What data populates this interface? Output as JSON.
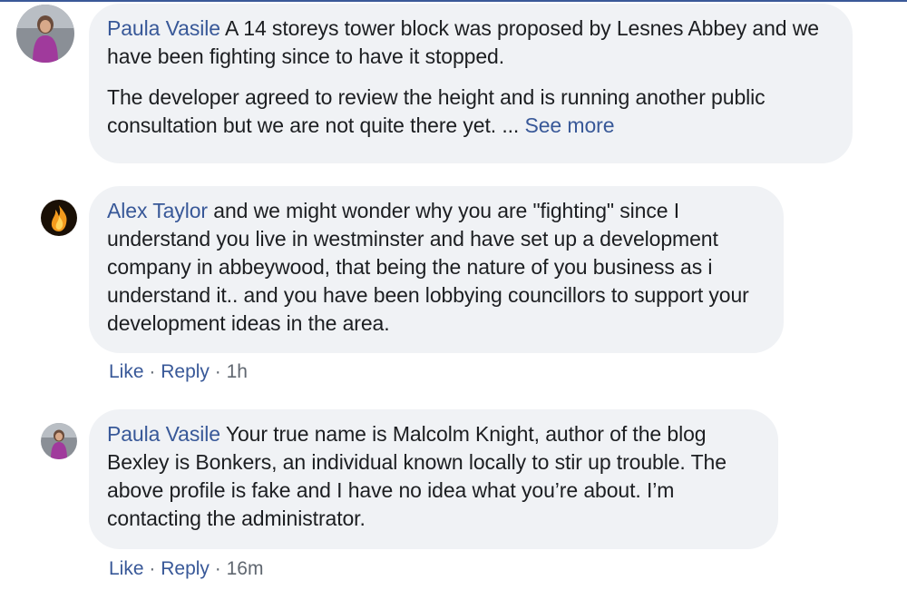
{
  "comments": [
    {
      "author": "Paula Vasile",
      "avatar_icon": "profile-photo-woman-purple-top",
      "paragraphs": [
        "A 14 storeys tower block was proposed by Lesnes Abbey and we have been fighting since to have it stopped.",
        "The developer agreed to review the height and is running another public consultation but we are not quite there yet. ..."
      ],
      "see_more": "See more"
    },
    {
      "author": "Alex Taylor",
      "avatar_icon": "profile-photo-flame",
      "text": "and we might wonder why you are \"fighting\" since I understand you live in westminster and have set up a development company in abbeywood, that being the nature of you business as i understand it.. and you have been lobbying councillors to support your development ideas in the area.",
      "actions": {
        "like": "Like",
        "sep": "·",
        "reply": "Reply",
        "time": "1h"
      }
    },
    {
      "author": "Paula Vasile",
      "avatar_icon": "profile-photo-woman-purple-top",
      "text": "Your true name is Malcolm Knight, author of the blog Bexley is Bonkers, an individual known locally to stir up trouble. The above profile is fake and I have no idea what you’re about. I’m contacting the administrator.",
      "actions": {
        "like": "Like",
        "sep": "·",
        "reply": "Reply",
        "time": "16m"
      }
    }
  ],
  "colors": {
    "author": "#385898",
    "bubble": "#f0f2f5",
    "meta": "#606770"
  }
}
